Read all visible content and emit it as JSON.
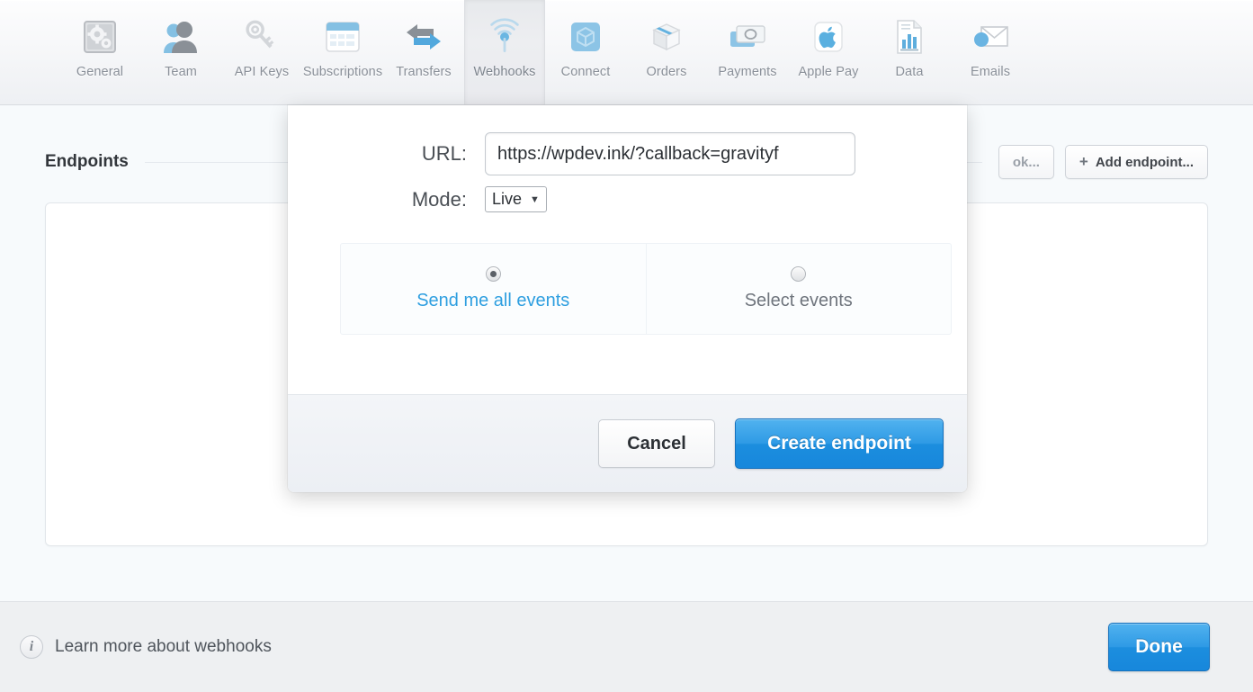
{
  "toolbar": {
    "tabs": [
      {
        "label": "General",
        "icon": "gear-icon",
        "active": false
      },
      {
        "label": "Team",
        "icon": "people-icon",
        "active": false
      },
      {
        "label": "API Keys",
        "icon": "key-icon",
        "active": false
      },
      {
        "label": "Subscriptions",
        "icon": "window-icon",
        "active": false
      },
      {
        "label": "Transfers",
        "icon": "transfer-arrows-icon",
        "active": false
      },
      {
        "label": "Webhooks",
        "icon": "antenna-icon",
        "active": true
      },
      {
        "label": "Connect",
        "icon": "cube-icon",
        "active": false
      },
      {
        "label": "Orders",
        "icon": "box-icon",
        "active": false
      },
      {
        "label": "Payments",
        "icon": "banknotes-icon",
        "active": false
      },
      {
        "label": "Apple Pay",
        "icon": "apple-icon",
        "active": false
      },
      {
        "label": "Data",
        "icon": "chart-document-icon",
        "active": false
      },
      {
        "label": "Emails",
        "icon": "envelope-icon",
        "active": false
      }
    ]
  },
  "page": {
    "section_title": "Endpoints",
    "test_webhook_label": "ok...",
    "add_endpoint_label": "Add endpoint...",
    "add_endpoint_plus": "+"
  },
  "modal": {
    "url_label": "URL:",
    "url_value": "https://wpdev.ink/?callback=gravityf",
    "url_placeholder": "https://",
    "mode_label": "Mode:",
    "mode_value": "Live",
    "mode_caret": "▼",
    "events": [
      {
        "label": "Send me all events",
        "selected": true
      },
      {
        "label": "Select events",
        "selected": false
      }
    ],
    "cancel_label": "Cancel",
    "create_label": "Create endpoint"
  },
  "footer": {
    "info_glyph": "i",
    "learn_more_label": "Learn more about webhooks",
    "done_label": "Done"
  },
  "colors": {
    "accent_blue": "#1c8ede",
    "link_blue": "#2f9fe0",
    "page_bg": "#f7fafc",
    "toolbar_bg": "#f1f3f5",
    "footer_bg": "#eef0f2"
  }
}
